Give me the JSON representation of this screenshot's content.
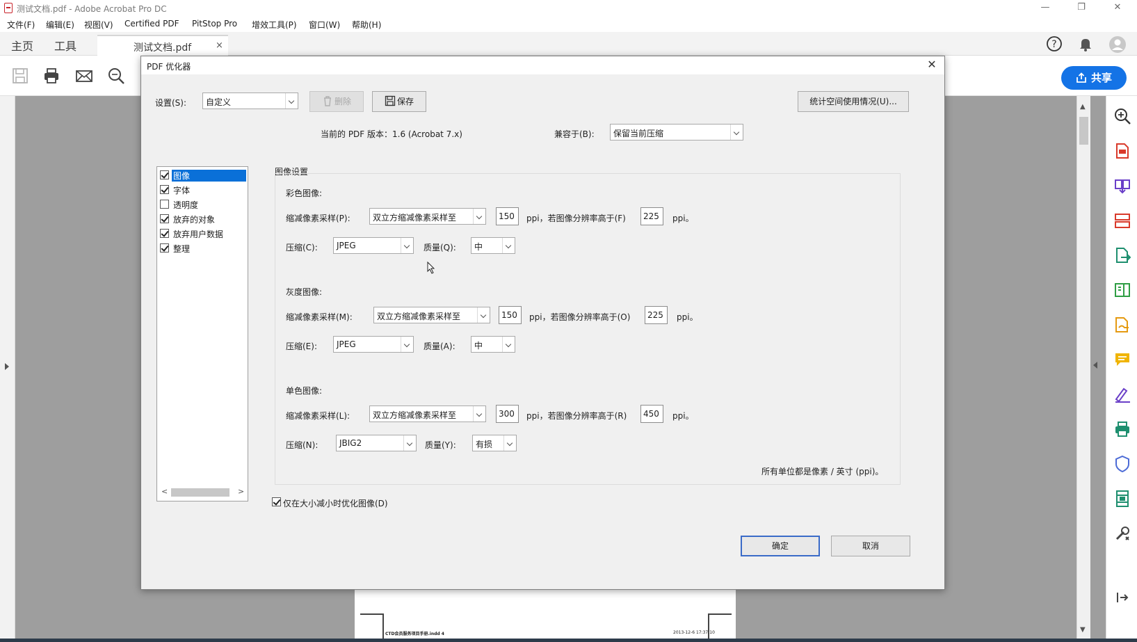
{
  "window": {
    "title": "测试文档.pdf - Adobe Acrobat Pro DC",
    "minimize_glyph": "—",
    "restore_glyph": "❐",
    "close_glyph": "✕"
  },
  "menu": [
    "文件(F)",
    "编辑(E)",
    "视图(V)",
    "Certified PDF",
    "PitStop Pro",
    "增效工具(P)",
    "窗口(W)",
    "帮助(H)"
  ],
  "tabs": {
    "home": "主页",
    "tools": "工具",
    "document": "测试文档.pdf",
    "document_close": "×"
  },
  "toolbar": {
    "share_label": "共享"
  },
  "dialog": {
    "title": "PDF 优化器",
    "close": "✕",
    "settings_label": "设置(S):",
    "settings_value": "自定义",
    "delete_label": "删除",
    "save_label": "保存",
    "audit_label": "统计空间使用情况(U)...",
    "current_version": "当前的 PDF 版本：1.6 (Acrobat 7.x)",
    "compat_label": "兼容于(B):",
    "compat_value": "保留当前压缩",
    "panels": [
      {
        "label": "图像",
        "checked": true,
        "selected": true
      },
      {
        "label": "字体",
        "checked": true,
        "selected": false
      },
      {
        "label": "透明度",
        "checked": false,
        "selected": false
      },
      {
        "label": "放弃的对象",
        "checked": true,
        "selected": false
      },
      {
        "label": "放弃用户数据",
        "checked": true,
        "selected": false
      },
      {
        "label": "整理",
        "checked": true,
        "selected": false
      }
    ],
    "group_title": "图像设置",
    "color": {
      "title": "彩色图像:",
      "downsample_label": "缩减像素采样(P):",
      "downsample_value": "双立方缩减像素采样至",
      "ppi": "150",
      "ppi_unit": "ppi，若图像分辨率高于(F)",
      "above": "225",
      "above_unit": "ppi。",
      "compression_label": "压缩(C):",
      "compression_value": "JPEG",
      "quality_label": "质量(Q):",
      "quality_value": "中"
    },
    "gray": {
      "title": "灰度图像:",
      "downsample_label": "缩减像素采样(M):",
      "downsample_value": "双立方缩减像素采样至",
      "ppi": "150",
      "ppi_unit": "ppi，若图像分辨率高于(O)",
      "above": "225",
      "above_unit": "ppi。",
      "compression_label": "压缩(E):",
      "compression_value": "JPEG",
      "quality_label": "质量(A):",
      "quality_value": "中"
    },
    "mono": {
      "title": "单色图像:",
      "downsample_label": "缩减像素采样(L):",
      "downsample_value": "双立方缩减像素采样至",
      "ppi": "300",
      "ppi_unit": "ppi，若图像分辨率高于(R)",
      "above": "450",
      "above_unit": "ppi。",
      "compression_label": "压缩(N):",
      "compression_value": "JBIG2",
      "quality_label": "质量(Y):",
      "quality_value": "有损"
    },
    "units_note": "所有单位都是像素 / 英寸 (ppi)。",
    "optimize_only_label": "仅在大小减小时优化图像(D)",
    "optimize_only_checked": true,
    "ok_label": "确定",
    "cancel_label": "取消"
  },
  "page": {
    "footer_left": "CTD会员服务项目手册.indd 4",
    "footer_right": "2013-12-6 17:37:10"
  },
  "icons": {
    "help": "help-icon",
    "bell": "notification-bell-icon",
    "avatar": "account-avatar-icon"
  },
  "colors": {
    "accent": "#1473e6",
    "selection": "#0a70d8",
    "workspace": "#9e9e9e"
  }
}
